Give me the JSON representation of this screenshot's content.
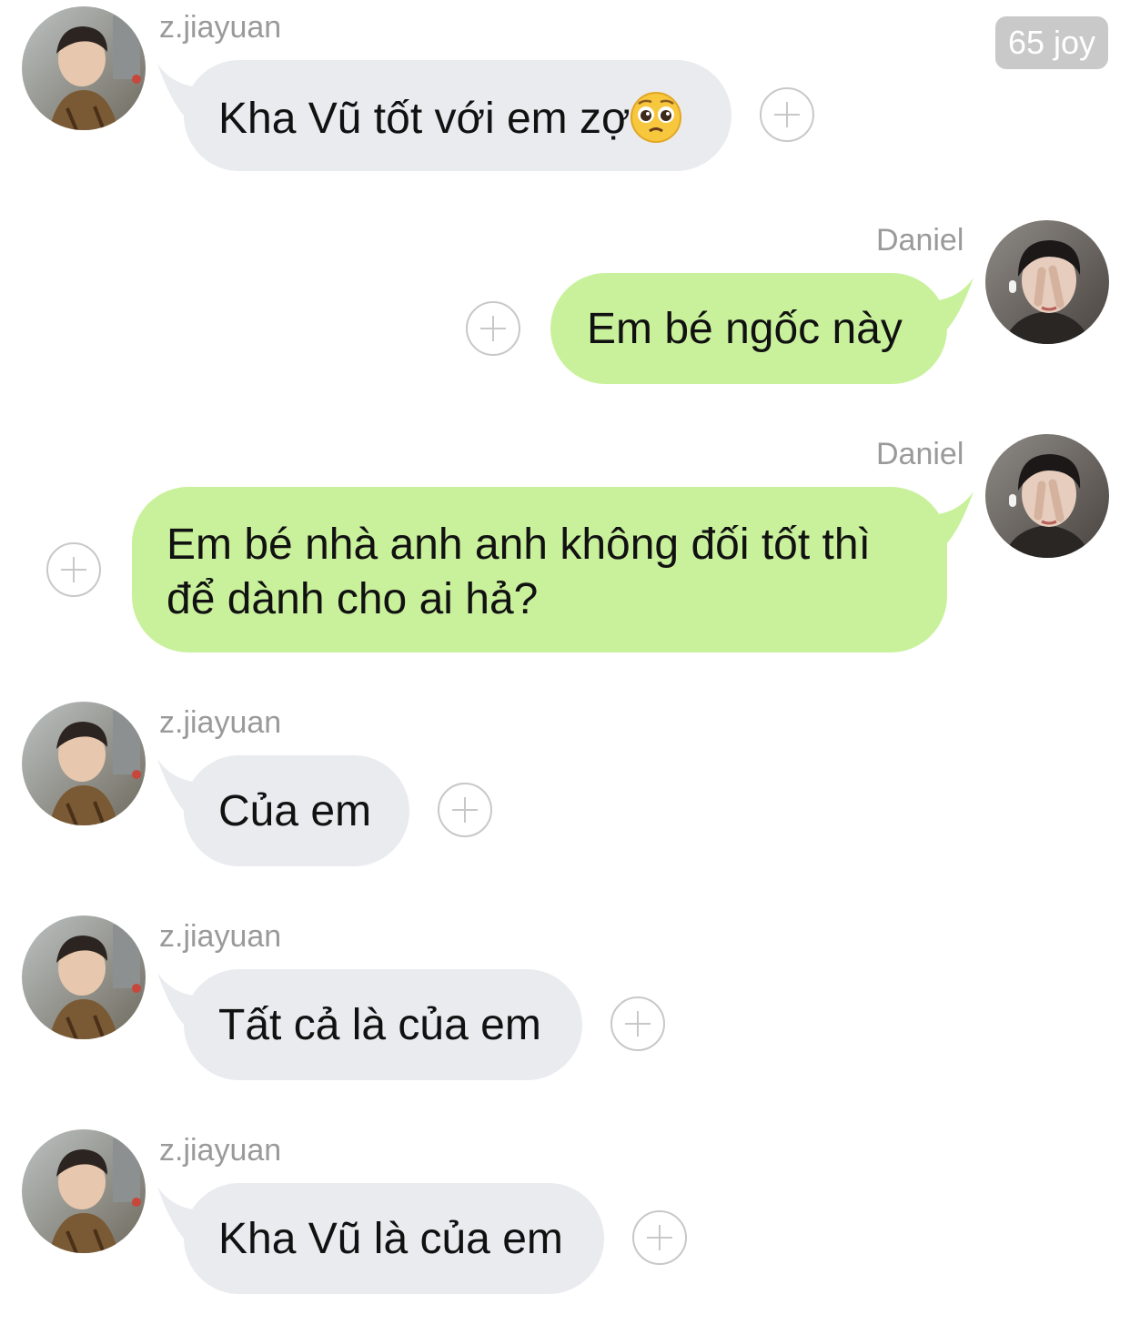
{
  "header": {
    "badge": "65 joy"
  },
  "messages": [
    {
      "sender": "z.jiayuan",
      "text": "Kha Vũ tốt với em zợ",
      "emoji": "pleading-face-emoji",
      "direction": "incoming"
    },
    {
      "sender": "Daniel",
      "text": "Em bé ngốc này",
      "direction": "outgoing"
    },
    {
      "sender": "Daniel",
      "line1": "Em bé nhà anh anh không đối tốt thì",
      "line2": "để dành cho ai hả?",
      "direction": "outgoing"
    },
    {
      "sender": "z.jiayuan",
      "text": "Của em",
      "direction": "incoming"
    },
    {
      "sender": "z.jiayuan",
      "text": "Tất cả là của em",
      "direction": "incoming"
    },
    {
      "sender": "z.jiayuan",
      "text": "Kha Vũ là của em",
      "direction": "incoming"
    }
  ],
  "colors": {
    "incoming_bubble": "#e9ebee",
    "outgoing_bubble": "#c9f19c",
    "sender_name": "#9a9a9a",
    "badge_background": "#c9c9c9"
  },
  "icons": {
    "add_reaction": "plus-circle-icon",
    "avatar_incoming": "avatar",
    "avatar_outgoing": "avatar"
  }
}
